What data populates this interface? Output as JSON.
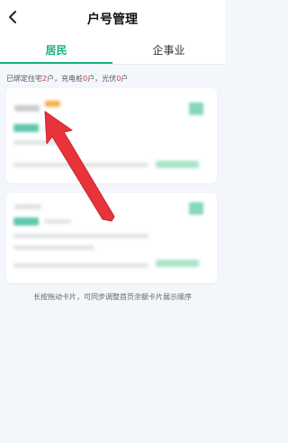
{
  "header": {
    "title": "户号管理",
    "back_icon": "back-chevron-icon"
  },
  "tabs": [
    {
      "label": "居民",
      "active": true
    },
    {
      "label": "企事业",
      "active": false
    }
  ],
  "summary": {
    "prefix": "已绑定住宅",
    "residential_count": "2",
    "mid1": "户，充电桩",
    "charger_count": "0",
    "mid2": "户，光伏",
    "pv_count": "0",
    "suffix": "户"
  },
  "hint": "长按拖动卡片，可同步调整首页余额卡片展示顺序",
  "colors": {
    "accent": "#19b27a",
    "count": "#e53935",
    "arrow": "#e8333a"
  }
}
